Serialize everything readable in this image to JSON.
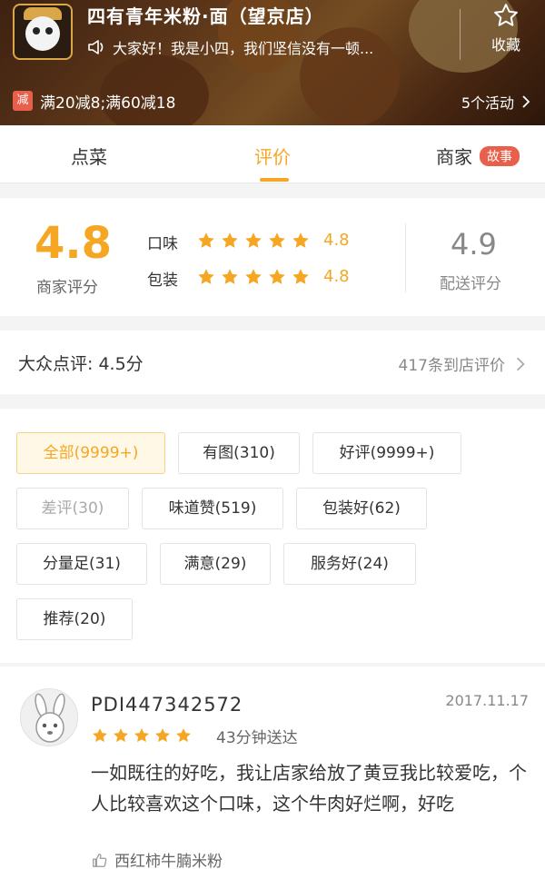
{
  "header": {
    "shop_name": "四有青年米粉·面（望京店）",
    "notice": "大家好！我是小四，我们坚信没有一顿...",
    "favorite_label": "收藏",
    "promo_tag": "减",
    "promo_text": "满20减8;满60减18",
    "activities": "5个活动"
  },
  "tabs": {
    "order": "点菜",
    "reviews": "评价",
    "merchant": "商家",
    "story_badge": "故事"
  },
  "rating": {
    "merchant_score": "4.8",
    "merchant_label": "商家评分",
    "taste_label": "口味",
    "taste_score": "4.8",
    "taste_stars": 5,
    "packing_label": "包装",
    "packing_score": "4.8",
    "packing_stars": 5,
    "delivery_score": "4.9",
    "delivery_label": "配送评分"
  },
  "dianping": {
    "label": "大众点评: 4.5分",
    "count": "417条到店评价"
  },
  "filters": [
    {
      "label": "全部(9999+)",
      "state": "active"
    },
    {
      "label": "有图(310)",
      "state": "normal"
    },
    {
      "label": "好评(9999+)",
      "state": "normal"
    },
    {
      "label": "差评(30)",
      "state": "muted"
    },
    {
      "label": "味道赞(519)",
      "state": "normal"
    },
    {
      "label": "包装好(62)",
      "state": "normal"
    },
    {
      "label": "分量足(31)",
      "state": "normal"
    },
    {
      "label": "满意(29)",
      "state": "normal"
    },
    {
      "label": "服务好(24)",
      "state": "normal"
    },
    {
      "label": "推荐(20)",
      "state": "normal"
    }
  ],
  "review": {
    "username": "PDI447342572",
    "date": "2017.11.17",
    "stars": 5,
    "delivery_time": "43分钟送达",
    "content": "一如既往的好吃，我让店家给放了黄豆我比较爱吃，个人比较喜欢这个口味，这个牛肉好烂啊，好吃",
    "dish": "西红柿牛腩米粉"
  },
  "colors": {
    "accent": "#f5a623",
    "badge": "#e8604c"
  }
}
